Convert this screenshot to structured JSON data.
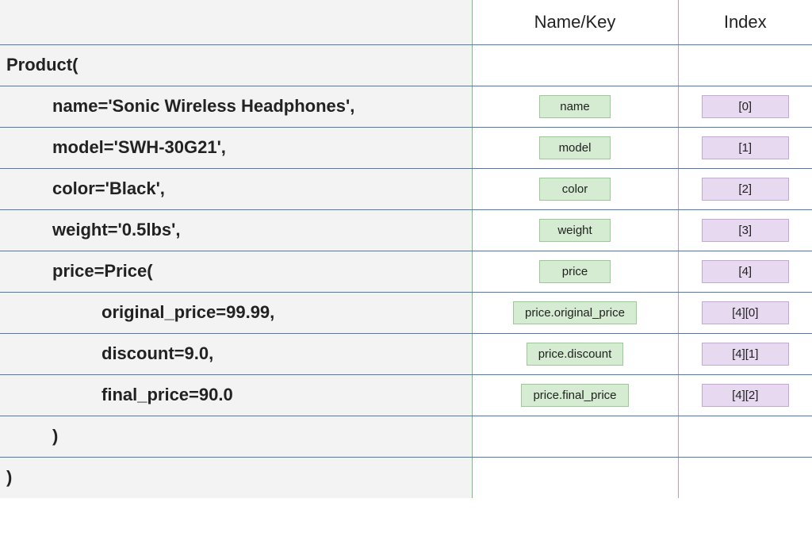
{
  "headers": {
    "code": "",
    "name_key": "Name/Key",
    "index": "Index"
  },
  "rows": [
    {
      "code": "Product(",
      "indent": "indent0",
      "name_key": "",
      "index": ""
    },
    {
      "code": "name='Sonic Wireless Headphones',",
      "indent": "indent1",
      "name_key": "name",
      "index": "[0]"
    },
    {
      "code": "model='SWH-30G21',",
      "indent": "indent1",
      "name_key": "model",
      "index": "[1]"
    },
    {
      "code": "color='Black',",
      "indent": "indent1",
      "name_key": "color",
      "index": "[2]"
    },
    {
      "code": "weight='0.5lbs',",
      "indent": "indent1",
      "name_key": "weight",
      "index": "[3]"
    },
    {
      "code": "price=Price(",
      "indent": "indent1",
      "name_key": "price",
      "index": "[4]"
    },
    {
      "code": "original_price=99.99,",
      "indent": "indent2",
      "name_key": "price.original_price",
      "index": "[4][0]"
    },
    {
      "code": "discount=9.0,",
      "indent": "indent2",
      "name_key": "price.discount",
      "index": "[4][1]"
    },
    {
      "code": "final_price=90.0",
      "indent": "indent2",
      "name_key": "price.final_price",
      "index": "[4][2]"
    },
    {
      "code": ")",
      "indent": "indent1",
      "name_key": "",
      "index": ""
    },
    {
      "code": ")",
      "indent": "indent0",
      "name_key": "",
      "index": ""
    }
  ]
}
